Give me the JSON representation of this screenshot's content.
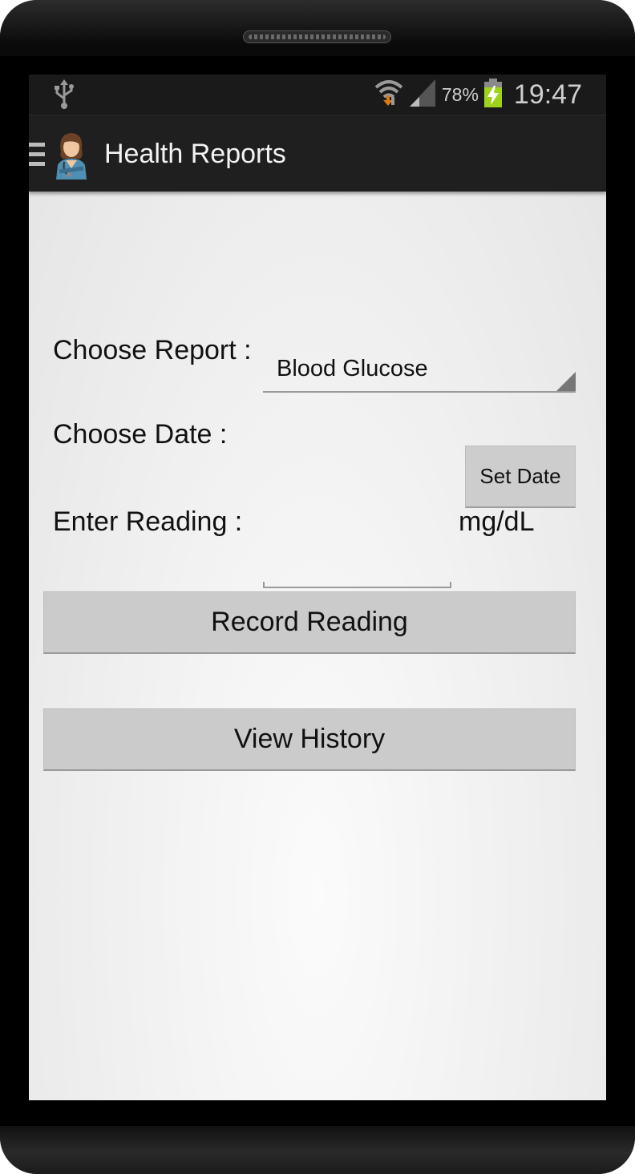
{
  "status_bar": {
    "usb_icon": "usb-icon",
    "wifi_icon": "wifi-icon",
    "signal_icon": "signal-icon",
    "battery_percent": "78%",
    "battery_icon": "battery-charging-icon",
    "time": "19:47"
  },
  "action_bar": {
    "menu_icon": "hamburger-menu-icon",
    "app_icon": "nurse-avatar-icon",
    "title": "Health Reports"
  },
  "form": {
    "report_label": "Choose Report :",
    "report_selected": "Blood Glucose",
    "date_label": "Choose Date :",
    "set_date_label": "Set Date",
    "reading_label": "Enter Reading :",
    "reading_value": "",
    "reading_unit": "mg/dL"
  },
  "actions": {
    "record_label": "Record Reading",
    "history_label": "View History"
  }
}
